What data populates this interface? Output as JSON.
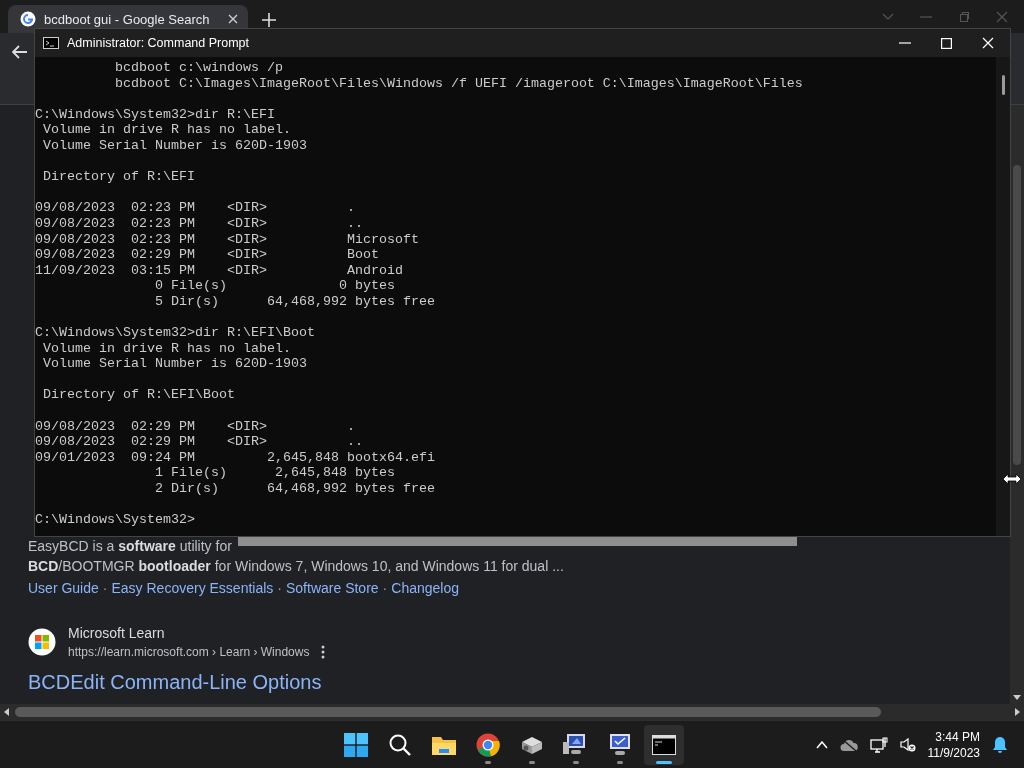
{
  "browser": {
    "tabs": [
      {
        "title": "bcdboot gui - Google Search",
        "selected": true
      }
    ]
  },
  "page": {
    "partial_snippet": "EasyBCD is a **software** utility for",
    "snippet": "**BCD**/BOOTMGR **bootloader** for Windows 7, Windows 10, and Windows 11 for dual ...",
    "sitelinks": [
      "User Guide",
      "Easy Recovery Essentials",
      "Software Store",
      "Changelog"
    ],
    "sitelink_separator": "·",
    "results": [
      {
        "source": "Microsoft Learn",
        "url": "https://learn.microsoft.com › Learn › Windows",
        "title": "BCDEdit Command-Line Options"
      }
    ]
  },
  "console": {
    "title": "Administrator: Command Prompt",
    "blocks": [
      [
        "          bcdboot c:\\windows /p",
        "          bcdboot C:\\Images\\ImageRoot\\Files\\Windows /f UEFI /imageroot C:\\Images\\ImageRoot\\Files"
      ],
      [
        "C:\\Windows\\System32>dir R:\\EFI",
        " Volume in drive R has no label.",
        " Volume Serial Number is 620D-1903"
      ],
      [
        " Directory of R:\\EFI"
      ],
      [
        "09/08/2023  02:23 PM    <DIR>          .",
        "09/08/2023  02:23 PM    <DIR>          ..",
        "09/08/2023  02:23 PM    <DIR>          Microsoft",
        "09/08/2023  02:29 PM    <DIR>          Boot",
        "11/09/2023  03:15 PM    <DIR>          Android",
        "               0 File(s)              0 bytes",
        "               5 Dir(s)      64,468,992 bytes free"
      ],
      [
        "C:\\Windows\\System32>dir R:\\EFI\\Boot",
        " Volume in drive R has no label.",
        " Volume Serial Number is 620D-1903"
      ],
      [
        " Directory of R:\\EFI\\Boot"
      ],
      [
        "09/08/2023  02:29 PM    <DIR>          .",
        "09/08/2023  02:29 PM    <DIR>          ..",
        "09/01/2023  09:24 PM         2,645,848 bootx64.efi",
        "               1 File(s)      2,645,848 bytes",
        "               2 Dir(s)      64,468,992 bytes free"
      ],
      [
        "C:\\Windows\\System32>"
      ]
    ]
  },
  "taskbar": {
    "apps": [
      {
        "kind": "start",
        "running": false,
        "selected": false
      },
      {
        "kind": "search",
        "running": false,
        "selected": false
      },
      {
        "kind": "folder",
        "running": false,
        "selected": false
      },
      {
        "kind": "browser",
        "running": true,
        "selected": false
      },
      {
        "kind": "drive",
        "running": true,
        "selected": false
      },
      {
        "kind": "computer",
        "running": true,
        "selected": false
      },
      {
        "kind": "monitor",
        "running": true,
        "selected": false
      },
      {
        "kind": "terminal",
        "running": true,
        "selected": true
      }
    ],
    "clock": {
      "time": "3:44 PM",
      "date": "11/9/2023"
    }
  }
}
